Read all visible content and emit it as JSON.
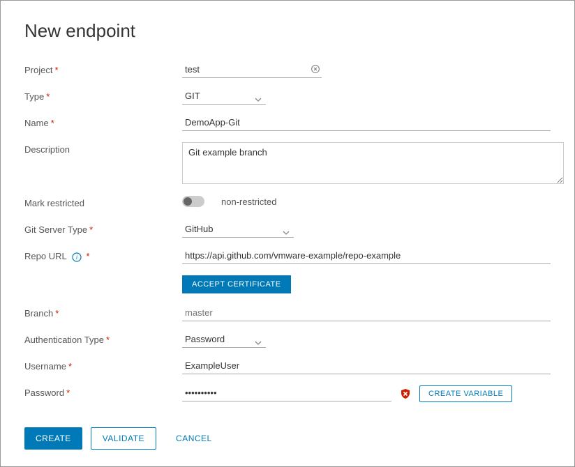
{
  "title": "New endpoint",
  "labels": {
    "project": "Project",
    "type": "Type",
    "name": "Name",
    "description": "Description",
    "mark_restricted": "Mark restricted",
    "git_server_type": "Git Server Type",
    "repo_url": "Repo URL",
    "branch": "Branch",
    "authentication_type": "Authentication Type",
    "username": "Username",
    "password": "Password"
  },
  "values": {
    "project": "test",
    "type": "GIT",
    "name": "DemoApp-Git",
    "description": "Git example branch",
    "restricted_label": "non-restricted",
    "git_server_type": "GitHub",
    "repo_url": "https://api.github.com/vmware-example/repo-example",
    "branch_placeholder": "master",
    "auth_type": "Password",
    "username": "ExampleUser",
    "password": "••••••••••"
  },
  "buttons": {
    "accept_cert": "ACCEPT CERTIFICATE",
    "create_var": "CREATE VARIABLE",
    "create": "CREATE",
    "validate": "VALIDATE",
    "cancel": "CANCEL"
  }
}
